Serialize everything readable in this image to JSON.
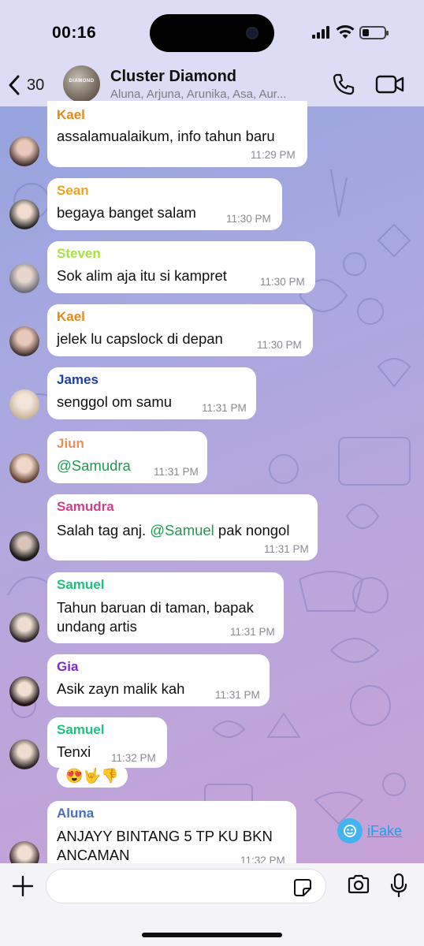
{
  "status_bar": {
    "time": "00:16",
    "battery_level": 0.3
  },
  "header": {
    "back_count": "30",
    "avatar_label": "DIAMOND",
    "title": "Cluster Diamond",
    "members": "Aluna, Arjuna, Arunika, Asa, Aur..."
  },
  "messages": [
    {
      "sender": "Kael",
      "color": "#e08a1e",
      "text": "assalamualaikum, info tahun baru",
      "time": "11:29 PM"
    },
    {
      "sender": "Sean",
      "color": "#f0a020",
      "text": "begaya banget salam",
      "time": "11:30 PM"
    },
    {
      "sender": "Steven",
      "color": "#a8e04a",
      "text": "Sok alim aja itu si kampret",
      "time": "11:30 PM"
    },
    {
      "sender": "Kael",
      "color": "#e08a1e",
      "text": "jelek lu capslock di depan",
      "time": "11:30 PM"
    },
    {
      "sender": "James",
      "color": "#1e3fb0",
      "text": "senggol om samu",
      "time": "11:31 PM"
    },
    {
      "sender": "Jiun",
      "color": "#e8905a",
      "text_mention": "@Samudra",
      "time": "11:31 PM"
    },
    {
      "sender": "Samudra",
      "color": "#d0408a",
      "text_pre": "Salah tag anj. ",
      "text_mention": "@Samuel",
      "text_post": " pak nongol",
      "time": "11:31 PM"
    },
    {
      "sender": "Samuel",
      "color": "#20c080",
      "text_line1": "Tahun baruan di taman, bapak",
      "text_line2": "undang artis",
      "time": "11:31 PM"
    },
    {
      "sender": "Gia",
      "color": "#7a2ad0",
      "text": "Asik zayn malik kah",
      "time": "11:31 PM"
    },
    {
      "sender": "Samuel",
      "color": "#20c080",
      "text": "Tenxi",
      "time": "11:32 PM",
      "reactions": "😍🤟👎"
    },
    {
      "sender": "Aluna",
      "color": "#4a6fc0",
      "text_line1": "ANJAYY BINTANG 5 TP KU BKN",
      "text_line2": "ANCAMAN",
      "time": "11:32 PM"
    }
  ],
  "watermark": {
    "label": "iFake"
  },
  "composer": {
    "placeholder": ""
  }
}
